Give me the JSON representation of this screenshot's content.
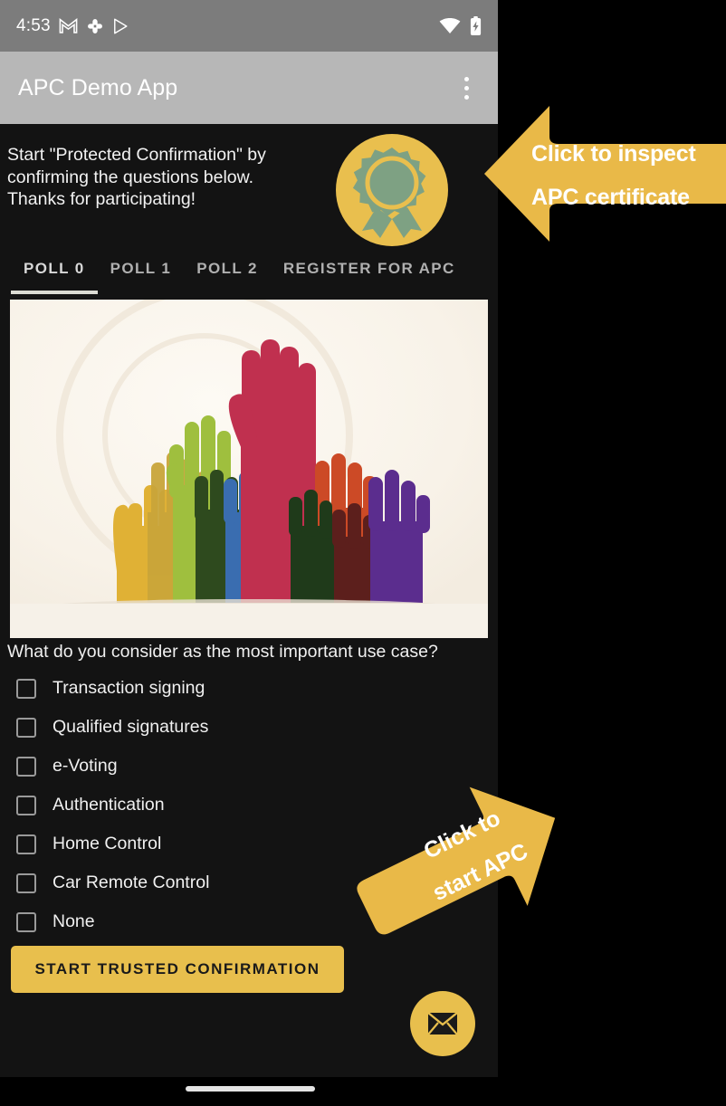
{
  "status_bar": {
    "time": "4:53",
    "icons_left": [
      "gmail-icon",
      "photos-icon",
      "play-store-icon"
    ],
    "icons_right": [
      "wifi-icon",
      "battery-charging-icon"
    ]
  },
  "app_bar": {
    "title": "APC Demo App",
    "overflow_icon": "more-vertical-icon"
  },
  "content": {
    "intro_text": "Start \"Protected Confirmation\" by\nconfirming the questions below.\nThanks for participating!",
    "certificate_badge_icon": "certificate-badge-icon",
    "question": "What do you consider as the most important use case?",
    "poll_image_alt": "raised-hands-illustration"
  },
  "tabs": [
    {
      "label": "POLL 0",
      "active": true
    },
    {
      "label": "POLL 1",
      "active": false
    },
    {
      "label": "POLL 2",
      "active": false
    },
    {
      "label": "REGISTER FOR APC",
      "active": false
    }
  ],
  "options": [
    {
      "label": "Transaction signing",
      "checked": false
    },
    {
      "label": "Qualified signatures",
      "checked": false
    },
    {
      "label": "e-Voting",
      "checked": false
    },
    {
      "label": "Authentication",
      "checked": false
    },
    {
      "label": "Home Control",
      "checked": false
    },
    {
      "label": "Car Remote Control",
      "checked": false
    },
    {
      "label": "None",
      "checked": false
    }
  ],
  "buttons": {
    "start_trusted_confirmation": "START TRUSTED CONFIRMATION",
    "mail_fab_icon": "envelope-icon"
  },
  "annotations": [
    {
      "text": "Click to inspect\nAPC certificate",
      "direction": "left"
    },
    {
      "text": "Click to\nstart APC",
      "direction": "down-left"
    }
  ],
  "colors": {
    "accent_yellow": "#e8bf4d",
    "annotation_yellow": "#e9b948",
    "app_bar_gray": "#b7b7b7",
    "status_bar_gray": "#7c7c7c",
    "background_dark": "#131313",
    "badge_green": "#7ea183"
  },
  "nav": {
    "gesture_pill": "home-gesture-pill"
  }
}
